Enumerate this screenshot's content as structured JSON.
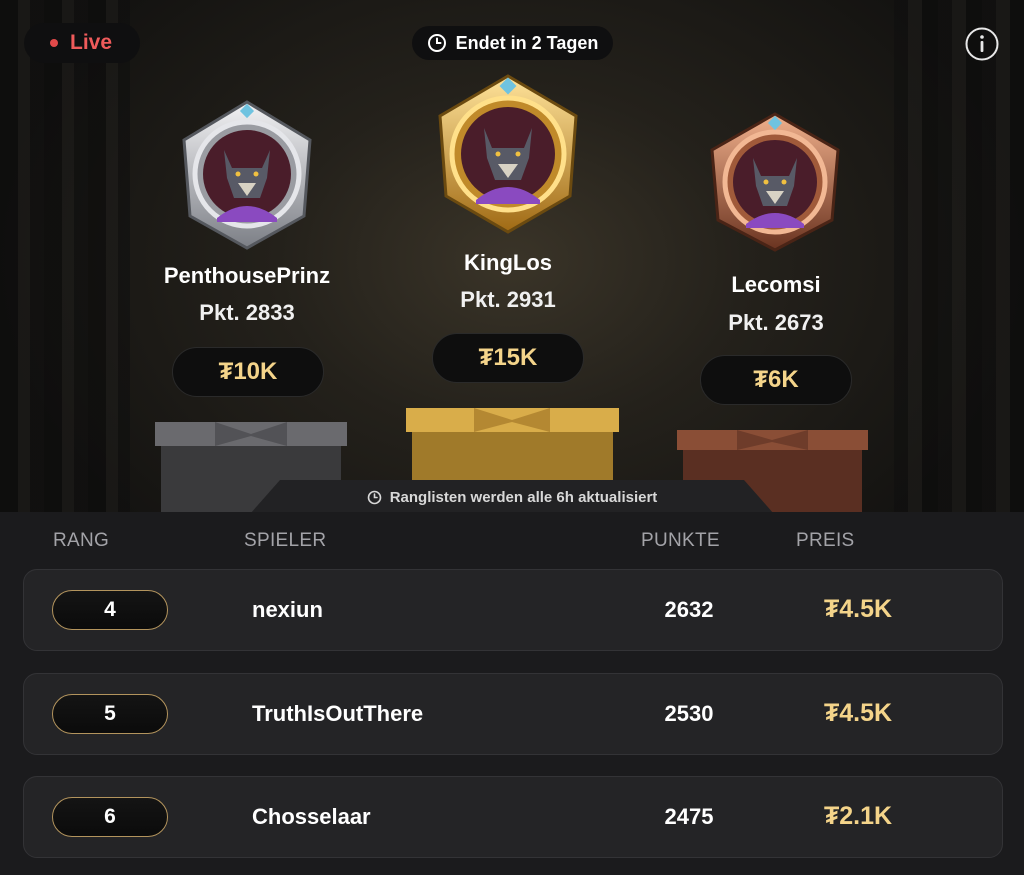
{
  "header": {
    "live_label": "Live",
    "ends_label": "Endet in 2 Tagen"
  },
  "podium": [
    {
      "place": 2,
      "name": "PenthousePrinz",
      "points": "Pkt. 2833",
      "prize": "₮10K",
      "medal": "silver"
    },
    {
      "place": 1,
      "name": "KingLos",
      "points": "Pkt. 2931",
      "prize": "₮15K",
      "medal": "gold"
    },
    {
      "place": 3,
      "name": "Lecomsi",
      "points": "Pkt. 2673",
      "prize": "₮6K",
      "medal": "bronze"
    }
  ],
  "update_note": "Ranglisten werden alle 6h aktualisiert",
  "table": {
    "headers": {
      "rank": "RANG",
      "player": "SPIELER",
      "points": "PUNKTE",
      "prize": "PREIS"
    },
    "rows": [
      {
        "rank": "4",
        "player": "nexiun",
        "points": "2632",
        "prize": "₮4.5K"
      },
      {
        "rank": "5",
        "player": "TruthIsOutThere",
        "points": "2530",
        "prize": "₮4.5K"
      },
      {
        "rank": "6",
        "player": "Chosselaar",
        "points": "2475",
        "prize": "₮2.1K"
      }
    ]
  },
  "colors": {
    "accent_gold": "#f4d48a",
    "live_red": "#ef5b5b",
    "silver": "#c9cbd0",
    "gold": "#d9a63a",
    "bronze": "#b86a4a"
  },
  "icons": [
    "clock-icon",
    "info-icon",
    "wolf-avatar-icon",
    "gift-box-icon"
  ]
}
